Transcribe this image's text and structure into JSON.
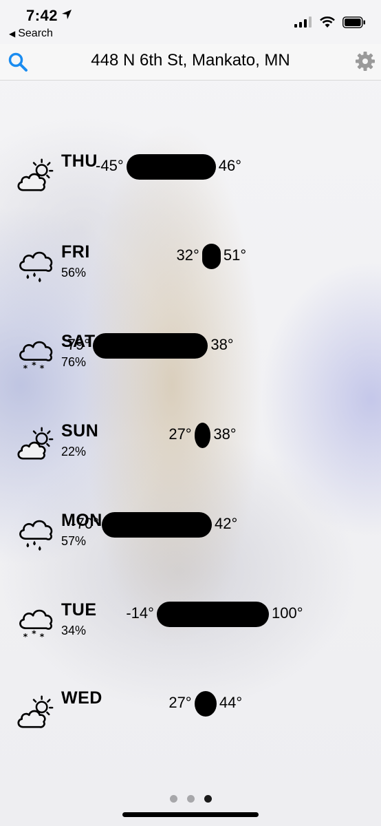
{
  "status_bar": {
    "time": "7:42",
    "back_label": "Search"
  },
  "nav": {
    "title": "448 N 6th St, Mankato, MN",
    "accent_color": "#1a8cf0"
  },
  "forecast": [
    {
      "day": "THU",
      "precip": "",
      "icon": "partly-cloudy-icon",
      "low": "-45°",
      "high": "46°",
      "low_value": -45,
      "high_value": 46
    },
    {
      "day": "FRI",
      "precip": "56%",
      "icon": "rain-icon",
      "low": "32°",
      "high": "51°",
      "low_value": 32,
      "high_value": 51
    },
    {
      "day": "SAT",
      "precip": "76%",
      "icon": "snow-icon",
      "low": "-79°",
      "high": "38°",
      "low_value": -79,
      "high_value": 38
    },
    {
      "day": "SUN",
      "precip": "22%",
      "icon": "partly-cloudy-icon",
      "low": "27°",
      "high": "38°",
      "low_value": 27,
      "high_value": 38
    },
    {
      "day": "MON",
      "precip": "57%",
      "icon": "rain-icon",
      "low": "-70°",
      "high": "42°",
      "low_value": -70,
      "high_value": 42
    },
    {
      "day": "TUE",
      "precip": "34%",
      "icon": "snow-icon",
      "low": "-14°",
      "high": "100°",
      "low_value": -14,
      "high_value": 100
    },
    {
      "day": "WED",
      "precip": "",
      "icon": "partly-cloudy-icon",
      "low": "27°",
      "high": "44°",
      "low_value": 27,
      "high_value": 44
    }
  ],
  "pager": {
    "count": 3,
    "active": 3
  }
}
